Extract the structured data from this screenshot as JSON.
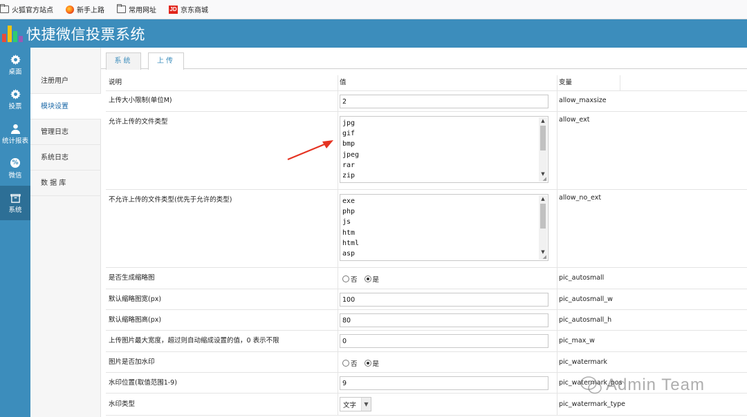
{
  "bookmarks": [
    {
      "label": "火狐官方站点",
      "icon": "folder-icon"
    },
    {
      "label": "新手上路",
      "icon": "firefox-icon"
    },
    {
      "label": "常用网址",
      "icon": "folder-icon"
    },
    {
      "label": "京东商城",
      "icon": "jd-icon",
      "badge": "JD"
    }
  ],
  "header": {
    "title": "快捷微信投票系统",
    "logo_colors": [
      "#e74c3c",
      "#f1c40f",
      "#2ecc71",
      "#9b59b6"
    ]
  },
  "iconbar": [
    {
      "label": "桌面",
      "icon": "gear-icon"
    },
    {
      "label": "投票",
      "icon": "gear-icon"
    },
    {
      "label": "统计报表",
      "icon": "user-icon"
    },
    {
      "label": "微信",
      "icon": "wechat-icon",
      "glyph": "%"
    },
    {
      "label": "系统",
      "icon": "box-icon",
      "active": true
    }
  ],
  "subnav": [
    {
      "label": "注册用户"
    },
    {
      "label": "模块设置",
      "active": true
    },
    {
      "label": "管理日志"
    },
    {
      "label": "系统日志"
    },
    {
      "label": "数 据 库"
    }
  ],
  "tabs": [
    {
      "label": "系统"
    },
    {
      "label": "上传",
      "active": true
    }
  ],
  "table": {
    "headers": [
      "说明",
      "值",
      "变量"
    ],
    "rows": [
      {
        "label": "上传大小限制(单位M)",
        "type": "text",
        "value": "2",
        "var": "allow_maxsize"
      },
      {
        "label": "允许上传的文件类型",
        "type": "textarea",
        "lines": [
          "jpg",
          "gif",
          "bmp",
          "jpeg",
          "rar",
          "zip"
        ],
        "var": "allow_ext"
      },
      {
        "label": "不允许上传的文件类型(优先于允许的类型)",
        "type": "textarea",
        "lines": [
          "exe",
          "php",
          "js",
          "htm",
          "html",
          "asp"
        ],
        "var": "allow_no_ext"
      },
      {
        "label": "是否生成缩略图",
        "type": "radio",
        "options": [
          "否",
          "是"
        ],
        "selected": "是",
        "var": "pic_autosmall"
      },
      {
        "label": "默认缩略图宽(px)",
        "type": "text",
        "value": "100",
        "var": "pic_autosmall_w"
      },
      {
        "label": "默认缩略图高(px)",
        "type": "text",
        "value": "80",
        "var": "pic_autosmall_h"
      },
      {
        "label": "上传图片最大宽度，超过则自动缩成设置的值，0 表示不限",
        "type": "text",
        "value": "0",
        "var": "pic_max_w"
      },
      {
        "label": "图片是否加水印",
        "type": "radio",
        "options": [
          "否",
          "是"
        ],
        "selected": "是",
        "var": "pic_watermark"
      },
      {
        "label": "水印位置(取值范围1-9)",
        "type": "text",
        "value": "9",
        "var": "pic_watermark_pos"
      },
      {
        "label": "水印类型",
        "type": "select",
        "value": "文字",
        "var": "pic_watermark_type"
      }
    ]
  },
  "watermark": {
    "text": "Admin Team"
  }
}
